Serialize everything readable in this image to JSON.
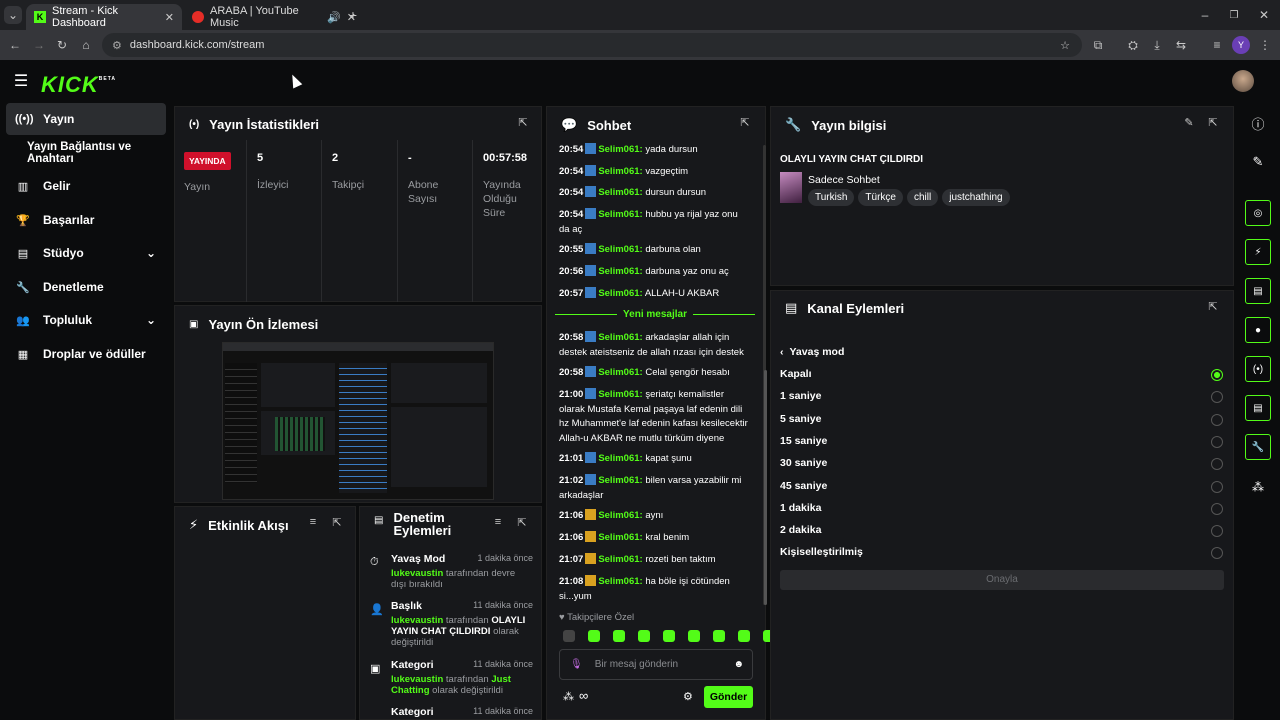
{
  "browser": {
    "tabs": [
      {
        "title": "Stream - Kick Dashboard",
        "active": true
      },
      {
        "title": "ARABA | YouTube Music",
        "active": false
      }
    ],
    "url": "dashboard.kick.com/stream",
    "profile_initial": "Y"
  },
  "app": {
    "logo": "KICK",
    "beta": "BETA"
  },
  "sidebar": [
    {
      "label": "Yayın",
      "icon": "broadcast-icon"
    },
    {
      "label": "Yayın Bağlantısı ve Anahtarı",
      "icon": ""
    },
    {
      "label": "Gelir",
      "icon": "chart-icon"
    },
    {
      "label": "Başarılar",
      "icon": "trophy-icon"
    },
    {
      "label": "Stüdyo",
      "icon": "studio-icon"
    },
    {
      "label": "Denetleme",
      "icon": "wrench-icon"
    },
    {
      "label": "Topluluk",
      "icon": "people-icon"
    },
    {
      "label": "Droplar ve ödüller",
      "icon": "drops-icon"
    }
  ],
  "stats": {
    "title": "Yayın İstatistikleri",
    "live_badge": "YAYINDA",
    "live_label": "Yayın",
    "items": [
      {
        "value": "5",
        "label": "İzleyici"
      },
      {
        "value": "2",
        "label": "Takipçi"
      },
      {
        "value": "-",
        "label": "Abone Sayısı"
      },
      {
        "value": "00:57:58",
        "label": "Yayında Olduğu Süre"
      }
    ]
  },
  "preview": {
    "title": "Yayın Ön İzlemesi"
  },
  "activity": {
    "title": "Etkinlik Akışı"
  },
  "modactions": {
    "title": "Denetim Eylemleri",
    "items": [
      {
        "title": "Yavaş Mod",
        "time": "1 dakika önce",
        "user": "lukevaustin",
        "pre": "tarafından devre dışı bırakıldı",
        "val": "",
        "post": ""
      },
      {
        "title": "Başlık",
        "time": "11 dakika önce",
        "user": "lukevaustin",
        "pre": "tarafından",
        "val": "OLAYLI YAYIN CHAT ÇILDIRDI",
        "post": "olarak değiştirildi"
      },
      {
        "title": "Kategori",
        "time": "11 dakika önce",
        "user": "lukevaustin",
        "pre": "tarafından",
        "val": "Just Chatting",
        "post": "olarak değiştirildi"
      },
      {
        "title": "Kategori",
        "time": "11 dakika önce",
        "user": "",
        "pre": "",
        "val": "",
        "post": ""
      }
    ]
  },
  "chat": {
    "title": "Sohbet",
    "new_messages": "Yeni mesajlar",
    "messages": [
      {
        "time": "20:54",
        "user": "Selim061:",
        "text": "yada dursun",
        "badge": "blue"
      },
      {
        "time": "20:54",
        "user": "Selim061:",
        "text": "vazgeçtim",
        "badge": "blue"
      },
      {
        "time": "20:54",
        "user": "Selim061:",
        "text": "dursun dursun",
        "badge": "blue"
      },
      {
        "time": "20:54",
        "user": "Selim061:",
        "text": "hubbu ya rijal yaz onu da aç",
        "badge": "blue"
      },
      {
        "time": "20:55",
        "user": "Selim061:",
        "text": "darbuna olan",
        "badge": "blue"
      },
      {
        "time": "20:56",
        "user": "Selim061:",
        "text": "darbuna yaz onu aç",
        "badge": "blue"
      },
      {
        "time": "20:57",
        "user": "Selim061:",
        "text": "ALLAH-U AKBAR",
        "badge": "blue"
      },
      {
        "time": "20:58",
        "user": "Selim061:",
        "text": "arkadaşlar allah için destek ateistseniz de allah rızası için destek",
        "badge": "blue"
      },
      {
        "time": "20:58",
        "user": "Selim061:",
        "text": "Celal şengör hesabı",
        "badge": "blue"
      },
      {
        "time": "21:00",
        "user": "Selim061:",
        "text": "şeriatçı kemalistler olarak Mustafa Kemal paşaya laf edenin dili hz Muhammet'e laf edenin kafası kesilecektir Allah-u AKBAR ne mutlu türküm diyene",
        "badge": "blue"
      },
      {
        "time": "21:01",
        "user": "Selim061:",
        "text": "kapat şunu",
        "badge": "blue"
      },
      {
        "time": "21:02",
        "user": "Selim061:",
        "text": "bilen varsa yazabilir mi arkadaşlar",
        "badge": "blue"
      },
      {
        "time": "21:06",
        "user": "Selim061:",
        "text": "aynı",
        "badge": "gold"
      },
      {
        "time": "21:06",
        "user": "Selim061:",
        "text": "kral benim",
        "badge": "gold"
      },
      {
        "time": "21:07",
        "user": "Selim061:",
        "text": "rozeti ben taktım",
        "badge": "gold"
      },
      {
        "time": "21:08",
        "user": "Selim061:",
        "text": "ha böle işi cötünden si...yum",
        "badge": "gold"
      }
    ],
    "followers_only": "Takipçilere Özel",
    "input_placeholder": "Bir mesaj gönderin",
    "send": "Gönder",
    "infinity": "∞"
  },
  "streaminfo": {
    "title": "Yayın bilgisi",
    "stream_title": "OLAYLI YAYIN CHAT ÇILDIRDI",
    "category": "Sadece Sohbet",
    "tags": [
      "Turkish",
      "Türkçe",
      "chill",
      "justchathing"
    ]
  },
  "channel": {
    "title": "Kanal Eylemleri",
    "back": "Yavaş mod",
    "options": [
      {
        "label": "Kapalı",
        "selected": true
      },
      {
        "label": "1 saniye",
        "selected": false
      },
      {
        "label": "5 saniye",
        "selected": false
      },
      {
        "label": "15 saniye",
        "selected": false
      },
      {
        "label": "30 saniye",
        "selected": false
      },
      {
        "label": "45 saniye",
        "selected": false
      },
      {
        "label": "1 dakika",
        "selected": false
      },
      {
        "label": "2 dakika",
        "selected": false
      },
      {
        "label": "Kişiselleştirilmiş",
        "selected": false
      }
    ],
    "confirm": "Onayla"
  },
  "colors": {
    "accent": "#53fc18",
    "live": "#d0102b"
  }
}
